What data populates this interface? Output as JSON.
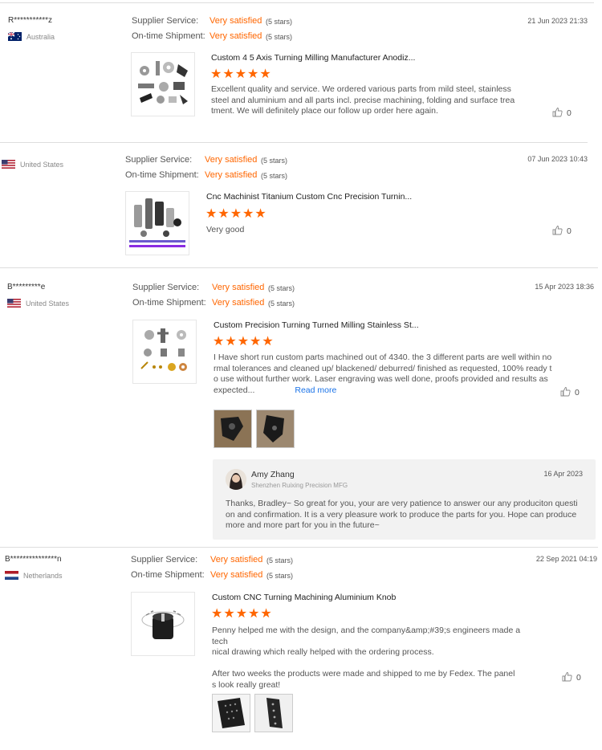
{
  "labels": {
    "supplier_service": "Supplier Service:",
    "ontime_shipment": "On-time Shipment:",
    "read_more": "Read more"
  },
  "reviews": [
    {
      "name": "R***********z",
      "country": "Australia",
      "supplier_value": "Very satisfied",
      "supplier_stars": "(5 stars)",
      "shipment_value": "Very satisfied",
      "shipment_stars": "(5 stars)",
      "date": "21 Jun 2023 21:33",
      "product_title": "Custom 4 5 Axis Turning Milling Manufacturer Anodiz...",
      "rating": "★★★★★",
      "text_lines": [
        "Excellent quality and service. We ordered various parts from mild steel, stainless",
        "steel and aluminium and all parts incl. precise machining, folding and surface trea",
        "tment. We will definitely place our follow up order here again."
      ],
      "likes": "0"
    },
    {
      "name": "",
      "country": "United States",
      "supplier_value": "Very satisfied",
      "supplier_stars": "(5 stars)",
      "shipment_value": "Very satisfied",
      "shipment_stars": "(5 stars)",
      "date": "07 Jun 2023 10:43",
      "product_title": "Cnc Machinist Titanium Custom Cnc Precision Turnin...",
      "rating": "★★★★★",
      "text_lines": [
        "Very good"
      ],
      "likes": "0"
    },
    {
      "name": "B*********e",
      "country": "United States",
      "supplier_value": "Very satisfied",
      "supplier_stars": "(5 stars)",
      "shipment_value": "Very satisfied",
      "shipment_stars": "(5 stars)",
      "date": "15 Apr 2023 18:36",
      "product_title": "Custom Precision Turning Turned Milling Stainless St...",
      "rating": "★★★★★",
      "text_lines": [
        "I Have short run custom parts machined out of 4340. the 3 different parts are well within no",
        "rmal tolerances and cleaned up/ blackened/ deburred/ finished as requested, 100% ready t",
        "o use without further work.   Laser engraving was well done, proofs provided and results as",
        "expected..."
      ],
      "likes": "0",
      "reply": {
        "author": "Amy Zhang",
        "company": "Shenzhen Ruixing Precision MFG",
        "date": "16 Apr 2023",
        "text_lines": [
          "Thanks, Bradley~ So great for you, your are very patience to answer our any produciton questi",
          "on and confirmation. It is a very pleasure work to produce the parts for you. Hope can produce",
          "more and more part for you in the future~"
        ]
      }
    },
    {
      "name": "B***************n",
      "country": "Netherlands",
      "supplier_value": "Very satisfied",
      "supplier_stars": "(5 stars)",
      "shipment_value": "Very satisfied",
      "shipment_stars": "(5 stars)",
      "date": "22 Sep 2021 04:19",
      "product_title": "Custom CNC Turning Machining Aluminium Knob",
      "rating": "★★★★★",
      "text_lines": [
        "Penny helped me with the design, and the company&amp;#39;s engineers made a tech",
        "nical drawing which really helped with the ordering process.",
        "",
        "After two weeks the products were made and shipped to me by Fedex. The panel",
        "s look really great!"
      ],
      "likes": "0"
    }
  ],
  "colors": {
    "accent": "#ff6600",
    "link": "#1a73e8",
    "reply_bg": "#f2f2f2"
  },
  "icons": {
    "like": "thumbs-up-icon",
    "star": "star-icon"
  }
}
